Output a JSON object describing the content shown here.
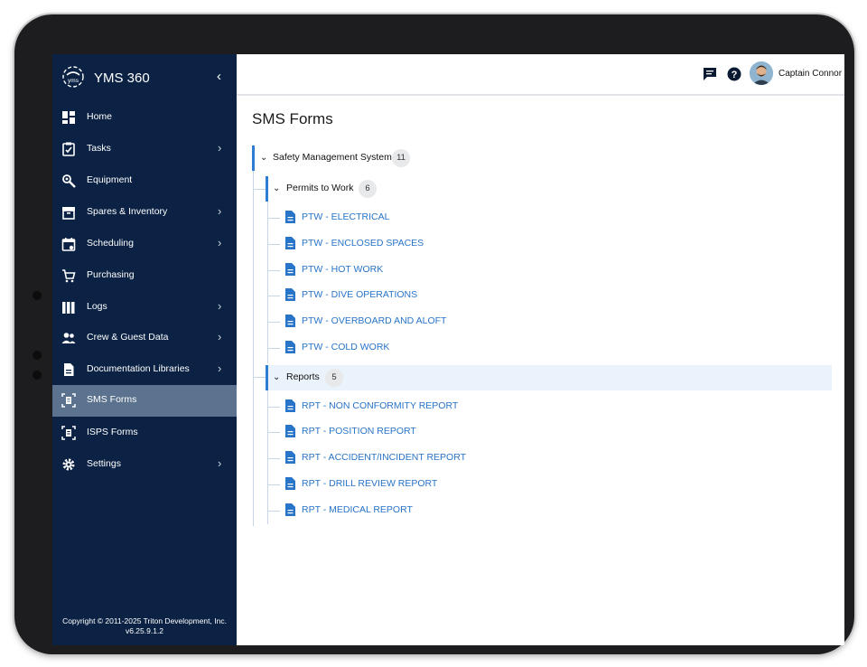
{
  "app": {
    "name": "YMS 360",
    "logo_text": "yms"
  },
  "sidebar": {
    "items": [
      {
        "label": "Home",
        "icon": "dashboard-icon",
        "has_submenu": false
      },
      {
        "label": "Tasks",
        "icon": "clipboard-check-icon",
        "has_submenu": true
      },
      {
        "label": "Equipment",
        "icon": "wrench-gear-icon",
        "has_submenu": false
      },
      {
        "label": "Spares & Inventory",
        "icon": "archive-box-icon",
        "has_submenu": true
      },
      {
        "label": "Scheduling",
        "icon": "calendar-icon",
        "has_submenu": true
      },
      {
        "label": "Purchasing",
        "icon": "shopping-cart-icon",
        "has_submenu": false
      },
      {
        "label": "Logs",
        "icon": "books-icon",
        "has_submenu": true
      },
      {
        "label": "Crew & Guest Data",
        "icon": "people-icon",
        "has_submenu": true
      },
      {
        "label": "Documentation Libraries",
        "icon": "document-icon",
        "has_submenu": true
      },
      {
        "label": "SMS Forms",
        "icon": "scan-document-icon",
        "has_submenu": false,
        "active": true
      },
      {
        "label": "ISPS Forms",
        "icon": "scan-document-icon",
        "has_submenu": false
      },
      {
        "label": "Settings",
        "icon": "gear-icon",
        "has_submenu": true
      }
    ],
    "copyright": "Copyright © 2011-2025 Triton Development, Inc.",
    "version": "v6.25.9.1.2"
  },
  "header": {
    "user_name": "Captain Connor"
  },
  "page": {
    "title": "SMS Forms"
  },
  "tree": {
    "root": {
      "label": "Safety Management System",
      "count": "11"
    },
    "groups": [
      {
        "label": "Permits to Work",
        "count": "6",
        "forms": [
          "PTW - ELECTRICAL",
          "PTW - ENCLOSED SPACES",
          "PTW - HOT WORK",
          "PTW - DIVE OPERATIONS",
          "PTW - OVERBOARD AND ALOFT",
          "PTW - COLD WORK"
        ]
      },
      {
        "label": "Reports",
        "count": "5",
        "forms": [
          "RPT - NON CONFORMITY REPORT",
          "RPT - POSITION REPORT",
          "RPT - ACCIDENT/INCIDENT REPORT",
          "RPT - DRILL REVIEW REPORT",
          "RPT - MEDICAL REPORT"
        ]
      }
    ]
  },
  "colors": {
    "sidebar_bg": "#0b2244",
    "active_item": "#5c7390",
    "link": "#2874c8",
    "accent": "#2d7dd2",
    "highlight_row": "#eaf2fb"
  }
}
